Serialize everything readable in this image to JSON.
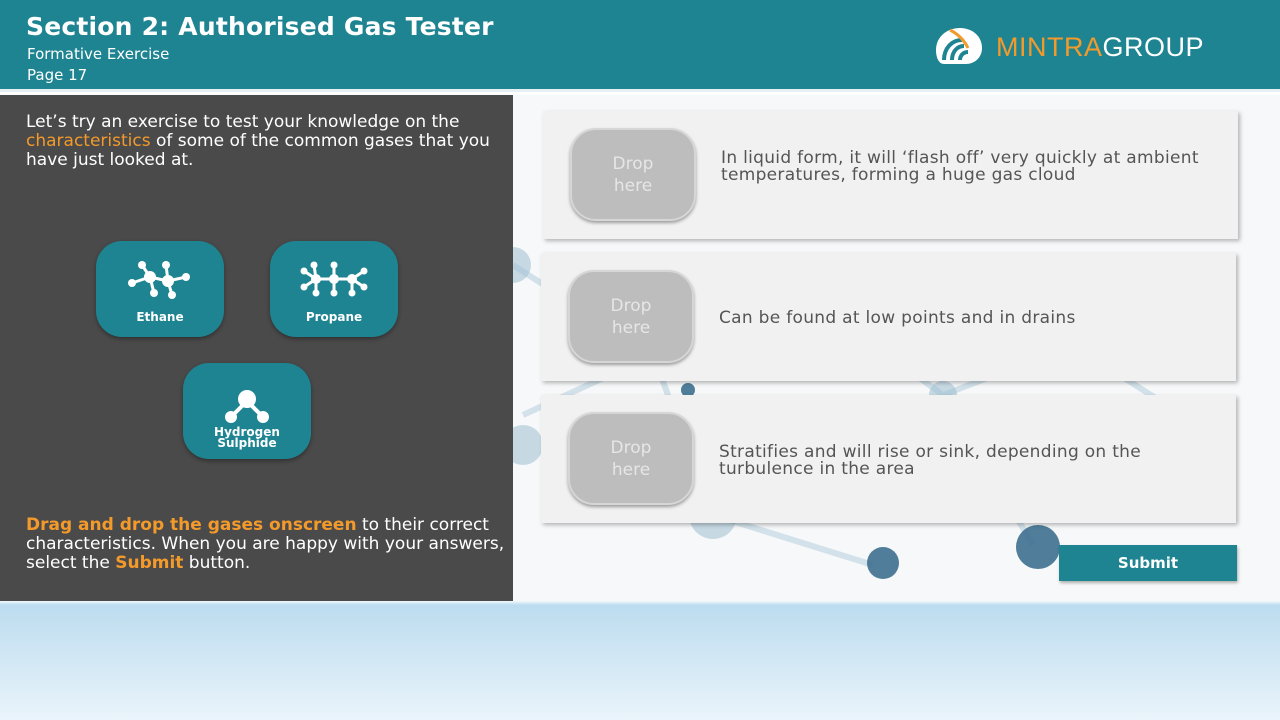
{
  "header": {
    "title": "Section 2: Authorised Gas Tester",
    "subtitle": "Formative Exercise",
    "page": "Page 17",
    "logo": {
      "part1": "MINTRA",
      "part2": "GROUP"
    }
  },
  "left_panel": {
    "intro": {
      "pre": "Let’s try an exercise to test your knowledge on the ",
      "highlight": "characteristics",
      "post": " of some of the common gases that you have just looked at."
    },
    "gases": [
      {
        "label": "Ethane",
        "icon": "ethane-molecule-icon"
      },
      {
        "label": "Propane",
        "icon": "propane-molecule-icon"
      },
      {
        "label": "Hydrogen Sulphide",
        "icon": "hydrogen-sulphide-molecule-icon"
      }
    ],
    "instructions": {
      "highlight1": "Drag and drop the gases onscreen",
      "text1": " to their correct characteristics. When you are happy with your answers, select the ",
      "highlight2": "Submit",
      "text2": " button."
    }
  },
  "cards": [
    {
      "drop_label": "Drop\nhere",
      "text": "In liquid form, it will ‘flash off’ very quickly at ambient temperatures, forming a huge gas cloud"
    },
    {
      "drop_label": "Drop\nhere",
      "text": "Can be found at low points and in drains"
    },
    {
      "drop_label": "Drop\nhere",
      "text": "Stratifies and will rise or sink, depending on the turbulence in the area"
    }
  ],
  "submit_label": "Submit",
  "colors": {
    "header_teal": "#1e8492",
    "accent_orange": "#f39a2b",
    "left_panel_bg": "#4a4a4a",
    "drop_zone_grey": "#bdbdbd"
  }
}
